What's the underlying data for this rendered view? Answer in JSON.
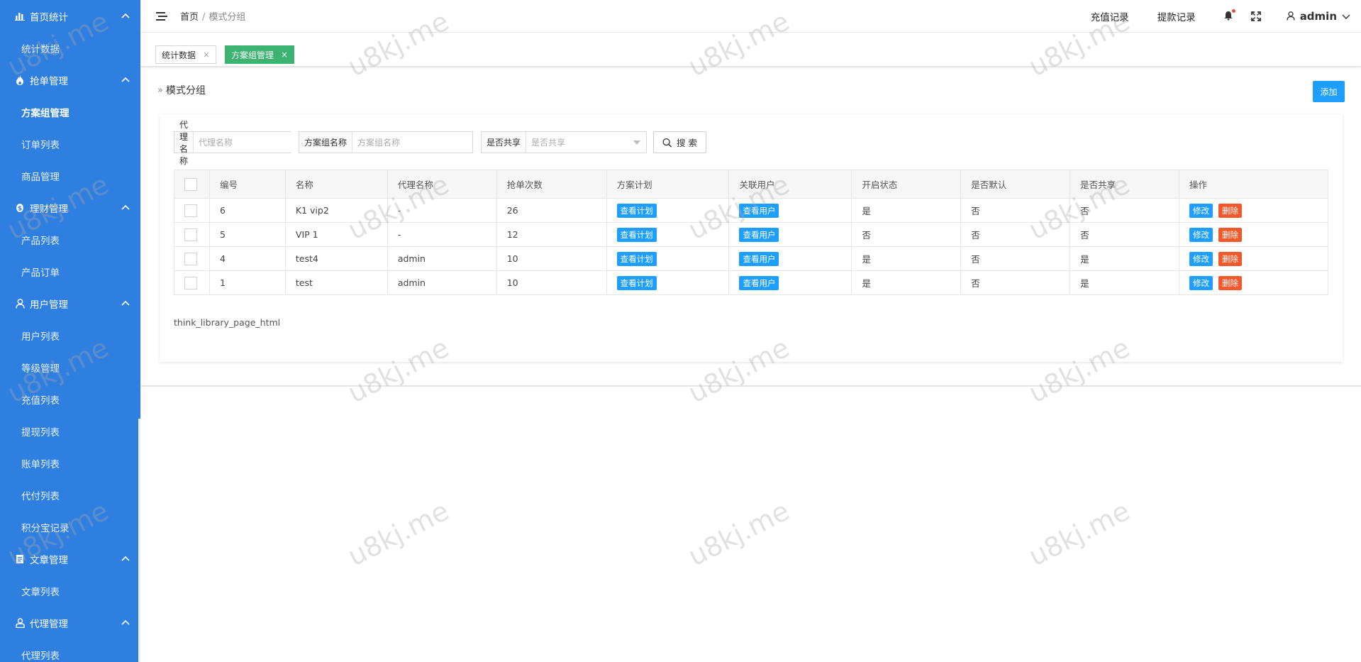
{
  "sidebar": {
    "groups": [
      {
        "label": "首页统计",
        "icon": "bar-chart-icon",
        "items": [
          "统计数据"
        ]
      },
      {
        "label": "抢单管理",
        "icon": "flame-icon",
        "items": [
          "方案组管理",
          "订单列表",
          "商品管理"
        ]
      },
      {
        "label": "理财管理",
        "icon": "coin-icon",
        "items": [
          "产品列表",
          "产品订单"
        ]
      },
      {
        "label": "用户管理",
        "icon": "user-icon",
        "items": [
          "用户列表",
          "等级管理",
          "充值列表",
          "提现列表",
          "账单列表",
          "代付列表",
          "积分宝记录"
        ]
      },
      {
        "label": "文章管理",
        "icon": "document-icon",
        "items": [
          "文章列表"
        ]
      },
      {
        "label": "代理管理",
        "icon": "agent-icon",
        "items": [
          "代理列表"
        ]
      }
    ],
    "active_item": "方案组管理"
  },
  "header": {
    "breadcrumb_home": "首页",
    "breadcrumb_sep": "/",
    "breadcrumb_current": "模式分组",
    "recharge_link": "充值记录",
    "withdraw_link": "提款记录",
    "username": "admin"
  },
  "tabs": [
    {
      "label": "统计数据",
      "close": "×",
      "active": false
    },
    {
      "label": "方案组管理",
      "close": "×",
      "active": true
    }
  ],
  "page": {
    "title": "模式分组",
    "add_label": "添加"
  },
  "filters": {
    "agent_label": "代理名称",
    "agent_placeholder": "代理名称",
    "group_label": "方案组名称",
    "group_placeholder": "方案组名称",
    "shared_label": "是否共享",
    "shared_placeholder": "是否共享",
    "search_label": "搜 索"
  },
  "table": {
    "columns": [
      "编号",
      "名称",
      "代理名称",
      "抢单次数",
      "方案计划",
      "关联用户",
      "开启状态",
      "是否默认",
      "是否共享",
      "操作"
    ],
    "rows": [
      {
        "id": "6",
        "name": "K1 vip2",
        "agent": "-",
        "count": "26",
        "plan_btn": "查看计划",
        "user_btn": "查看用户",
        "enabled": "是",
        "is_default": "否",
        "shared": "否",
        "edit": "修改",
        "delete": "删除"
      },
      {
        "id": "5",
        "name": "VIP 1",
        "agent": "-",
        "count": "12",
        "plan_btn": "查看计划",
        "user_btn": "查看用户",
        "enabled": "否",
        "is_default": "否",
        "shared": "否",
        "edit": "修改",
        "delete": "删除"
      },
      {
        "id": "4",
        "name": "test4",
        "agent": "admin",
        "count": "10",
        "plan_btn": "查看计划",
        "user_btn": "查看用户",
        "enabled": "是",
        "is_default": "否",
        "shared": "是",
        "edit": "修改",
        "delete": "删除"
      },
      {
        "id": "1",
        "name": "test",
        "agent": "admin",
        "count": "10",
        "plan_btn": "查看计划",
        "user_btn": "查看用户",
        "enabled": "是",
        "is_default": "否",
        "shared": "是",
        "edit": "修改",
        "delete": "删除"
      }
    ]
  },
  "pager_text": "think_library_page_html",
  "watermark": "u8kj.me",
  "colors": {
    "sidebar_bg": "#2f7fe0",
    "primary": "#1e9fff",
    "danger": "#f1582c",
    "tab_active": "#3cb371",
    "notification_dot": "#e74c3c"
  }
}
